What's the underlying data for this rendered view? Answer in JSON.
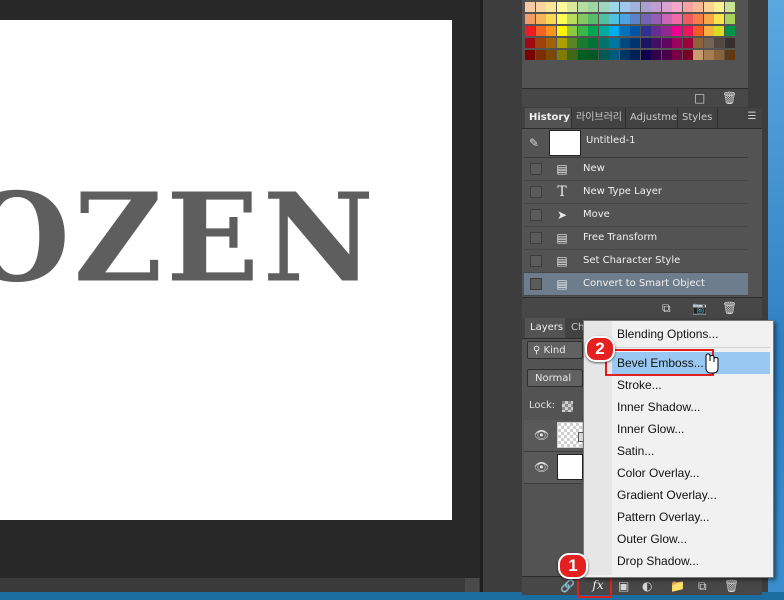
{
  "canvas": {
    "artwork_text": "OZEN"
  },
  "history": {
    "tabs": [
      "History",
      "라이브러리",
      "Adjustme",
      "Styles"
    ],
    "snapshot_label": "Untitled-1",
    "items": [
      "New",
      "New Type Layer",
      "Move",
      "Free Transform",
      "Set Character Style",
      "Convert to Smart Object"
    ],
    "selected_index": 5
  },
  "layers": {
    "tabs": [
      "Layers",
      "Ch"
    ],
    "kind_label": "Kind",
    "blend_mode": "Normal",
    "lock_label": "Lock:"
  },
  "fx_button": {
    "label": "fx"
  },
  "layer_style_menu": {
    "items": [
      "Blending Options...",
      "Bevel  Emboss...",
      "Stroke...",
      "Inner Shadow...",
      "Inner Glow...",
      "Satin...",
      "Color Overlay...",
      "Gradient Overlay...",
      "Pattern Overlay...",
      "Outer Glow...",
      "Drop Shadow..."
    ],
    "highlighted_index": 1
  },
  "step_badges": [
    "1",
    "2"
  ],
  "colors": {
    "annotation_red": "#e52020",
    "menu_hover": "#99c9f2",
    "history_selected": "#6e7d8c",
    "text_gray": "#5e5e5e"
  },
  "swatch_colors": [
    [
      "#f7c9a4",
      "#f8d59f",
      "#fbe79c",
      "#fefa9c",
      "#d9ea9c",
      "#b8dda1",
      "#9dd6a0",
      "#9dd7c2",
      "#9ed8e6",
      "#9fc8ed",
      "#a2b3dd",
      "#ab9fd0",
      "#c09fd0",
      "#dca3d2",
      "#f4a7c6",
      "#f5a3a3",
      "#f9b896",
      "#fdd292",
      "#fef192",
      "#c8e495"
    ],
    [
      "#f29b66",
      "#f5b55d",
      "#f9d856",
      "#fffc54",
      "#b9dd5b",
      "#87c864",
      "#58bd69",
      "#51c0a1",
      "#4ec2df",
      "#4ea4e2",
      "#5b84c8",
      "#7164b5",
      "#955eb3",
      "#c966b5",
      "#ef6aa6",
      "#ee5b5e",
      "#f47d4b",
      "#f9a647",
      "#fde44a",
      "#a6d45a"
    ],
    [
      "#ed1c24",
      "#f26522",
      "#f7941d",
      "#fff200",
      "#8dc63f",
      "#39b54a",
      "#00a651",
      "#00a99d",
      "#00aeef",
      "#0072bc",
      "#0054a6",
      "#2e3192",
      "#662d91",
      "#92278f",
      "#ec008c",
      "#ed145b",
      "#f15a24",
      "#fbb040",
      "#d7df23",
      "#009245"
    ],
    [
      "#9e0b0f",
      "#a0410d",
      "#a3620a",
      "#aba000",
      "#598527",
      "#197b30",
      "#007236",
      "#00746b",
      "#0076a3",
      "#004a80",
      "#003471",
      "#1b1464",
      "#440e62",
      "#630460",
      "#9e005d",
      "#9e0039",
      "#8c6239",
      "#736357",
      "#534741",
      "#362f2d"
    ],
    [
      "#790000",
      "#7b2e00",
      "#7d4900",
      "#827b00",
      "#406618",
      "#005e20",
      "#005826",
      "#005952",
      "#005b7f",
      "#003663",
      "#002157",
      "#0d004c",
      "#32004b",
      "#4b0049",
      "#7b0046",
      "#7a0026",
      "#c69c6d",
      "#a67c52",
      "#8c6239",
      "#603913"
    ]
  ]
}
